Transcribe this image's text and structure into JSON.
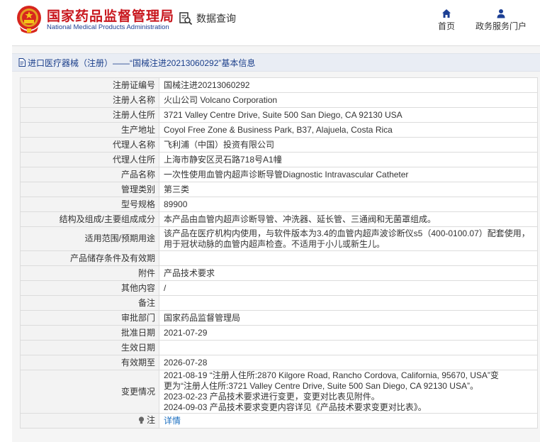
{
  "header": {
    "brand_cn": "国家药品监督管理局",
    "brand_en": "National Medical Products Administration",
    "query_label": "数据查询",
    "nav_home": "首页",
    "nav_portal": "政务服务门户",
    "brand_color": "#c8161d",
    "accent_color": "#1c3f94"
  },
  "panel": {
    "title": "进口医疗器械（注册）——“国械注进20213060292”基本信息"
  },
  "rows": [
    {
      "k": "注册证编号",
      "v": "国械注进20213060292"
    },
    {
      "k": "注册人名称",
      "v": "火山公司 Volcano Corporation"
    },
    {
      "k": "注册人住所",
      "v": "3721 Valley Centre Drive, Suite 500 San Diego, CA 92130 USA"
    },
    {
      "k": "生产地址",
      "v": "Coyol Free Zone & Business Park, B37, Alajuela, Costa Rica"
    },
    {
      "k": "代理人名称",
      "v": "飞利浦（中国）投资有限公司"
    },
    {
      "k": "代理人住所",
      "v": "上海市静安区灵石路718号A1幢"
    },
    {
      "k": "产品名称",
      "v": "一次性使用血管内超声诊断导管Diagnostic Intravascular Catheter"
    },
    {
      "k": "管理类别",
      "v": "第三类"
    },
    {
      "k": "型号规格",
      "v": "89900"
    },
    {
      "k": "结构及组成/主要组成成分",
      "v": "本产品由血管内超声诊断导管、冲洗器、延长管、三通阀和无菌罩组成。"
    },
    {
      "k": "适用范围/预期用途",
      "v": "该产品在医疗机构内使用，与软件版本为3.4的血管内超声波诊断仪s5（400-0100.07）配套使用，用于冠状动脉的血管内超声检查。不适用于小儿或新生儿。"
    },
    {
      "k": "产品储存条件及有效期",
      "v": ""
    },
    {
      "k": "附件",
      "v": "产品技术要求"
    },
    {
      "k": "其他内容",
      "v": "/"
    },
    {
      "k": "备注",
      "v": ""
    },
    {
      "k": "审批部门",
      "v": "国家药品监督管理局"
    },
    {
      "k": "批准日期",
      "v": "2021-07-29"
    },
    {
      "k": "生效日期",
      "v": ""
    },
    {
      "k": "有效期至",
      "v": "2026-07-28"
    }
  ],
  "changes": {
    "k": "变更情况",
    "lines": [
      "2021-08-19 “注册人住所:2870 Kilgore Road, Rancho Cordova, California, 95670, USA”变",
      "更为“注册人住所:3721 Valley Centre Drive, Suite 500 San Diego, CA 92130 USA”。",
      "2023-02-23 产品技术要求进行变更，变更对比表见附件。",
      "2024-09-03 产品技术要求变更内容详见《产品技术要求变更对比表》。"
    ]
  },
  "note": {
    "k": "注",
    "link": "详情",
    "icon": "lightbulb-icon"
  }
}
